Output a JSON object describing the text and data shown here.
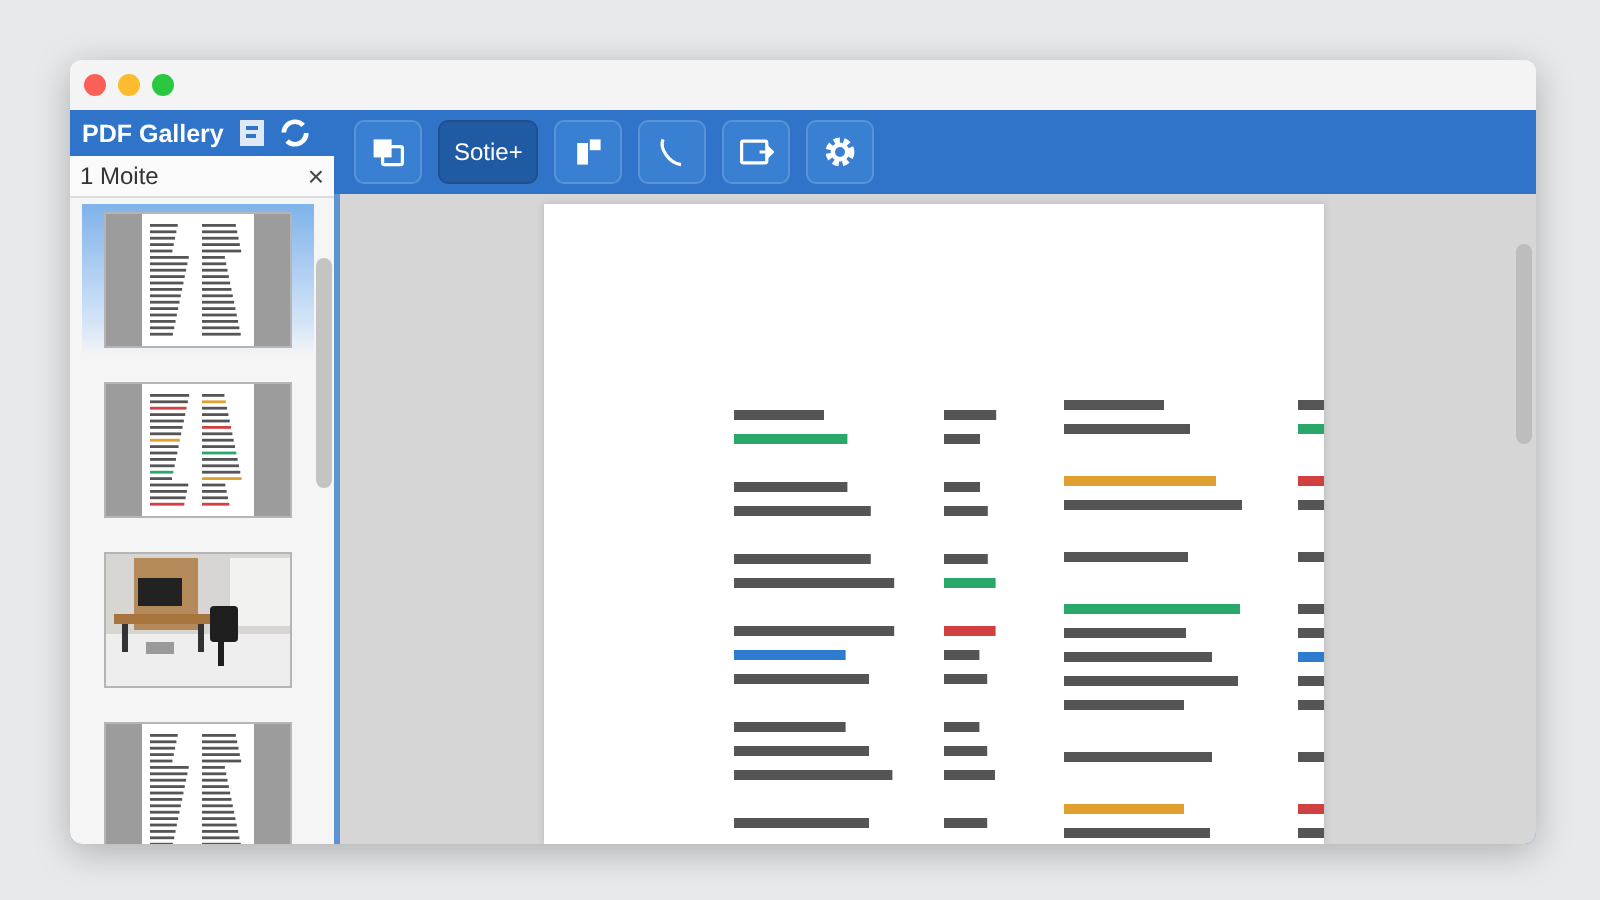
{
  "window": {
    "title": "PDF Gallery"
  },
  "title_icons": [
    {
      "kind": "page"
    },
    {
      "kind": "sync"
    }
  ],
  "toolbar": [
    {
      "kind": "copy",
      "selected": false
    },
    {
      "kind": "label",
      "label": "Sotie+",
      "selected": true
    },
    {
      "kind": "door",
      "selected": false
    },
    {
      "kind": "phone",
      "selected": false
    },
    {
      "kind": "export",
      "selected": false
    },
    {
      "kind": "settings",
      "selected": false
    }
  ],
  "sidebar": {
    "title": "1 Moite",
    "close": "×",
    "thumbnails": [
      {
        "kind": "page",
        "selected": true
      },
      {
        "kind": "highlighted-page",
        "selected": false
      },
      {
        "kind": "picture",
        "selected": false
      },
      {
        "kind": "page",
        "selected": false
      }
    ]
  }
}
